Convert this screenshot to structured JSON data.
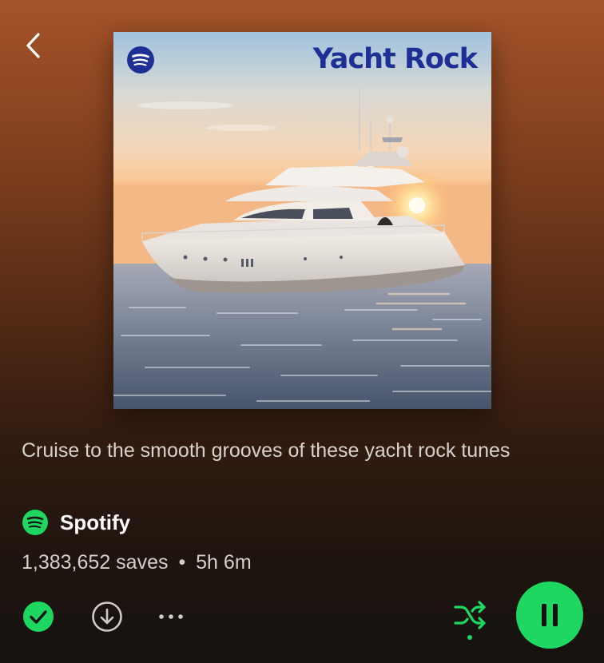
{
  "nav": {
    "back_icon": "chevron-left-icon"
  },
  "cover": {
    "title": "Yacht Rock",
    "logo_icon": "spotify-icon",
    "title_color": "#1e2f96"
  },
  "playlist": {
    "description": "Cruise to the smooth grooves of these yacht rock tunes",
    "owner": "Spotify",
    "owner_icon": "spotify-icon",
    "saves": "1,383,652 saves",
    "separator": "•",
    "duration": "5h 6m"
  },
  "actions": {
    "saved_icon": "check-circle-icon",
    "download_icon": "download-icon",
    "more_icon": "ellipsis-icon",
    "shuffle_icon": "shuffle-icon",
    "pause_icon": "pause-icon"
  },
  "colors": {
    "accent": "#1ed760",
    "background_top": "#a5542a",
    "background_bottom": "#161210"
  }
}
